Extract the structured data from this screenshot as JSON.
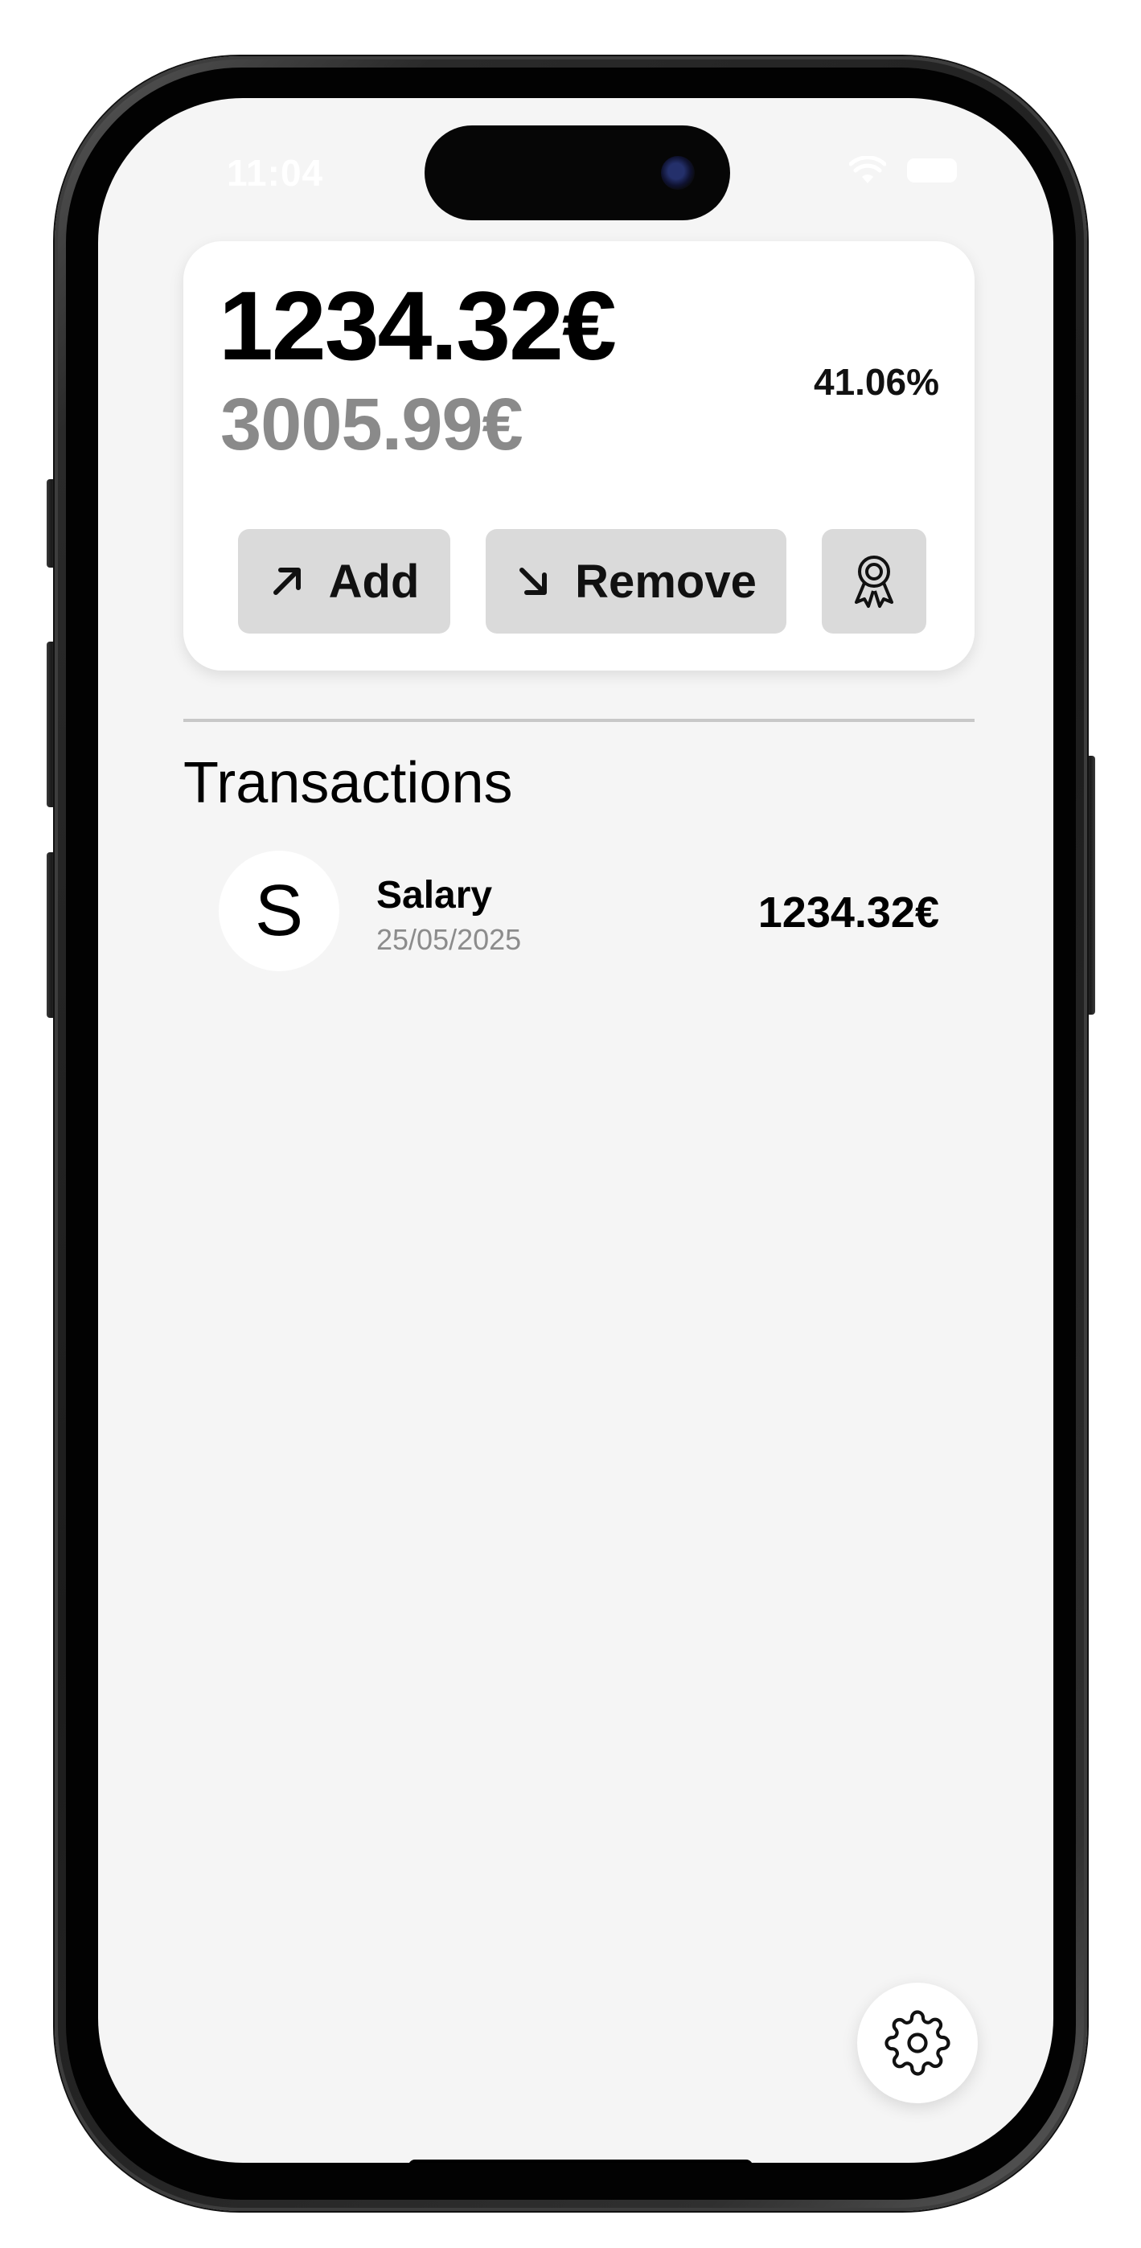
{
  "status_bar": {
    "time": "11:04",
    "icons": [
      "wifi-icon",
      "battery-icon"
    ]
  },
  "balance_card": {
    "current_amount": "1234.32€",
    "goal_amount": "3005.99€",
    "progress_percent": "41.06%",
    "progress_value": 41.06,
    "add_button": {
      "label": "Add",
      "icon": "arrow-up-right-icon"
    },
    "remove_button": {
      "label": "Remove",
      "icon": "arrow-down-right-icon"
    },
    "award_button": {
      "icon": "award-ribbon-icon"
    }
  },
  "transactions": {
    "title": "Transactions",
    "items": [
      {
        "initial": "S",
        "name": "Salary",
        "date": "25/05/2025",
        "amount": "1234.32€"
      }
    ]
  },
  "settings_button": {
    "icon": "gear-icon"
  },
  "colors": {
    "screen_background": "#f5f5f5",
    "card_background": "#ffffff",
    "button_background": "#dadada",
    "primary_text": "#000000",
    "secondary_text": "#8a8a8a"
  }
}
